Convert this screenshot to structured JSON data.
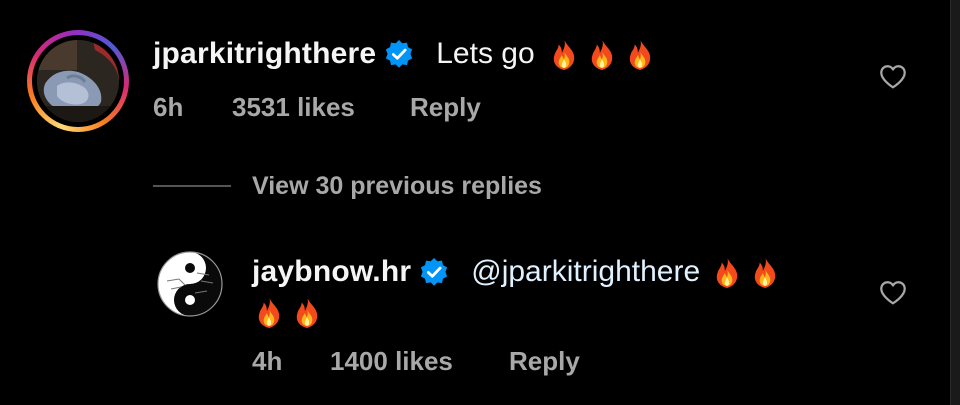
{
  "comment": {
    "username": "jparkitrighthere",
    "text": "Lets go",
    "emoji_count": 3,
    "time": "6h",
    "likes": "3531 likes",
    "reply_label": "Reply"
  },
  "replies_toggle": {
    "label": "View 30 previous replies"
  },
  "reply": {
    "username": "jaybnow.hr",
    "mention": "@jparkitrighthere",
    "emoji_count": 4,
    "time": "4h",
    "likes": "1400 likes",
    "reply_label": "Reply"
  },
  "icons": {
    "verified": "verified-badge-icon",
    "like": "heart-outline-icon",
    "emoji": "fire-emoji"
  },
  "colors": {
    "background": "#000000",
    "primary_text": "#f5f5f5",
    "secondary_text": "#a8a8a8",
    "verified_blue": "#0095f6"
  }
}
